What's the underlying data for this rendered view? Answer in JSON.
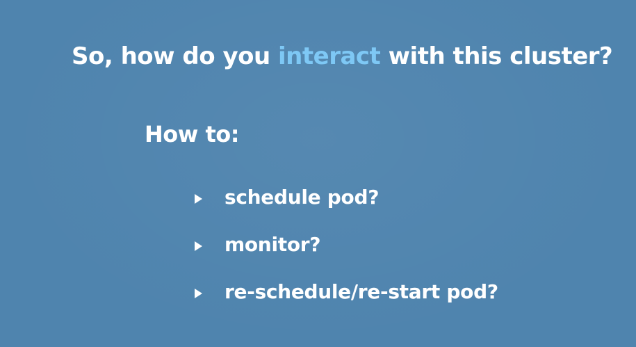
{
  "title": {
    "before": "So, how do you ",
    "accent": "interact",
    "after": " with this cluster?",
    "accent_color": "#7ec8f5"
  },
  "subtitle": "How to:",
  "bullets": [
    "schedule pod?",
    "monitor?",
    "re-schedule/re-start pod?"
  ],
  "colors": {
    "background": "#4f84ae",
    "text": "#ffffff"
  },
  "icons": {
    "bullet": "triangle-right-icon"
  }
}
